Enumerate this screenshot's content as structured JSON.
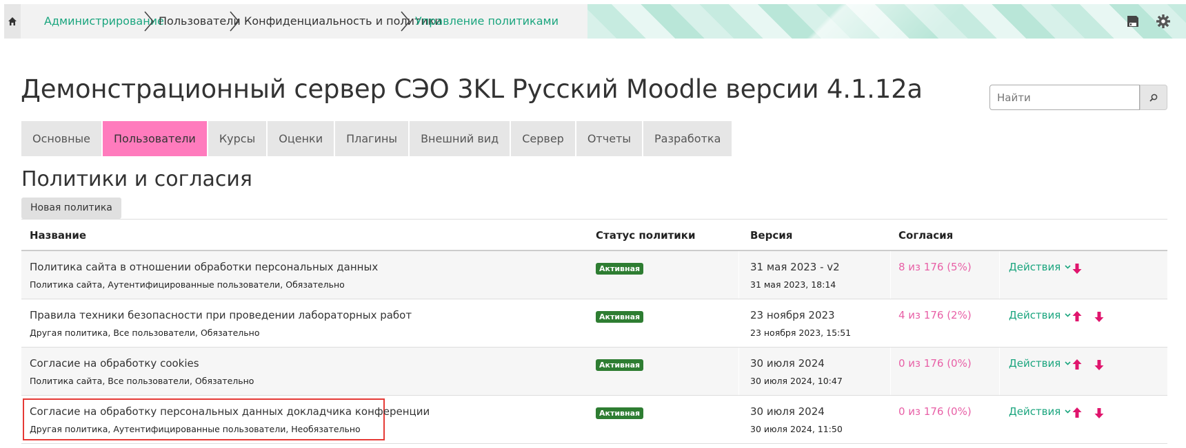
{
  "breadcrumb": {
    "items": [
      {
        "label": "Администрирование"
      },
      {
        "label": "Пользователи"
      },
      {
        "label": "Конфиденциальность и политики"
      },
      {
        "label": "Управление политиками"
      }
    ]
  },
  "header": {
    "site_title": "Демонстрационный сервер СЭО 3KL Русский Moodle версии 4.1.12а",
    "search_placeholder": "Найти"
  },
  "tabs": [
    {
      "label": "Основные"
    },
    {
      "label": "Пользователи",
      "active": true
    },
    {
      "label": "Курсы"
    },
    {
      "label": "Оценки"
    },
    {
      "label": "Плагины"
    },
    {
      "label": "Внешний вид"
    },
    {
      "label": "Сервер"
    },
    {
      "label": "Отчеты"
    },
    {
      "label": "Разработка"
    }
  ],
  "page": {
    "heading": "Политики и согласия",
    "new_policy_label": "Новая политика"
  },
  "table": {
    "columns": {
      "name": "Название",
      "status": "Статус политики",
      "version": "Версия",
      "consents": "Согласия"
    },
    "rows": [
      {
        "name": "Политика сайта в отношении обработки персональных данных",
        "meta": "Политика сайта, Аутентифицированные пользователи, Обязательно",
        "status": "Активная",
        "version": "31 мая 2023 - v2",
        "version_date": "31 мая 2023, 18:14",
        "consents": "8 из 176 (5%)",
        "actions": "Действия",
        "move_up": false,
        "move_down": true
      },
      {
        "name": "Правила техники безопасности при проведении лабораторных работ",
        "meta": "Другая политика, Все пользователи, Обязательно",
        "status": "Активная",
        "version": "23 ноября 2023",
        "version_date": "23 ноября 2023, 15:51",
        "consents": "4 из 176 (2%)",
        "actions": "Действия",
        "move_up": true,
        "move_down": true
      },
      {
        "name": "Согласие на обработку cookies",
        "meta": "Политика сайта, Все пользователи, Обязательно",
        "status": "Активная",
        "version": "30 июля 2024",
        "version_date": "30 июля 2024, 10:47",
        "consents": "0 из 176 (0%)",
        "actions": "Действия",
        "move_up": true,
        "move_down": true
      },
      {
        "name": "Согласие на обработку персональных данных докладчика конференции",
        "meta": "Другая политика, Аутентифицированные пользователи, Необязательно",
        "status": "Активная",
        "version": "30 июля 2024",
        "version_date": "30 июля 2024, 11:50",
        "consents": "0 из 176 (0%)",
        "actions": "Действия",
        "move_up": true,
        "move_down": true,
        "highlighted": true
      }
    ]
  },
  "colors": {
    "accent_teal": "#1aa57e",
    "accent_pink": "#ff7bbd",
    "consent_pink": "#e85fa6",
    "arrow_pink": "#e0156d",
    "badge_green": "#2e7d32",
    "highlight_red": "#e53935"
  },
  "icons": {
    "home": "home-icon",
    "save": "save-icon",
    "settings": "gear-icon",
    "search": "search-icon",
    "actions_chevron": "chevron-down-icon",
    "move_up": "arrow-up-icon",
    "move_down": "arrow-down-icon"
  }
}
